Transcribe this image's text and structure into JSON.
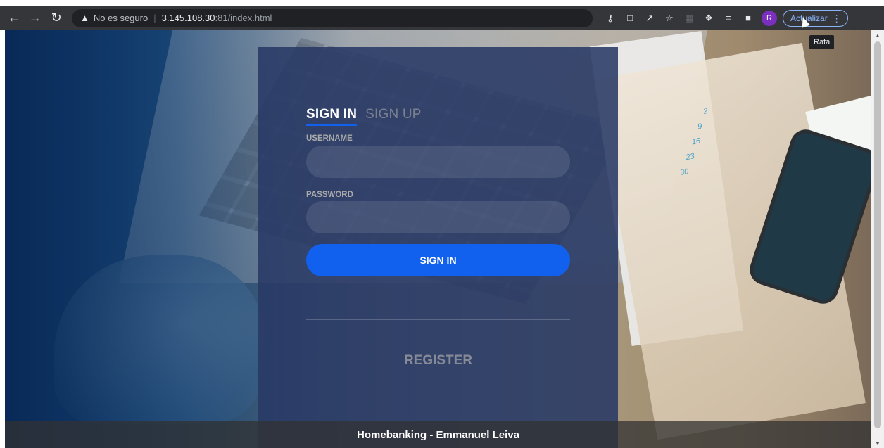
{
  "browser": {
    "nav": {
      "back_icon": "arrow-left-icon",
      "forward_icon": "arrow-right-icon",
      "reload_icon": "reload-icon"
    },
    "omnibox": {
      "security_label": "No es seguro",
      "host": "3.145.108.30",
      "path": ":81/index.html"
    },
    "toolbar_icons": [
      "key-icon",
      "translate-icon",
      "share-icon",
      "star-icon",
      "extension-dim-icon",
      "puzzle-icon",
      "reading-list-icon",
      "sidebar-icon"
    ],
    "profile": {
      "initial": "R",
      "tooltip": "Rafa"
    },
    "update_button": "Actualizar"
  },
  "page": {
    "tabs": {
      "signin": "SIGN IN",
      "signup": "SIGN UP"
    },
    "username_label": "USERNAME",
    "password_label": "PASSWORD",
    "signin_button": "SIGN IN",
    "register_link": "REGISTER",
    "footer": "Homebanking - Emmanuel Leiva",
    "background_numbers": [
      "2",
      "9",
      "16",
      "23",
      "30"
    ]
  },
  "colors": {
    "accent": "#1161ee",
    "card": "#283965",
    "toolbar": "#35363a"
  }
}
